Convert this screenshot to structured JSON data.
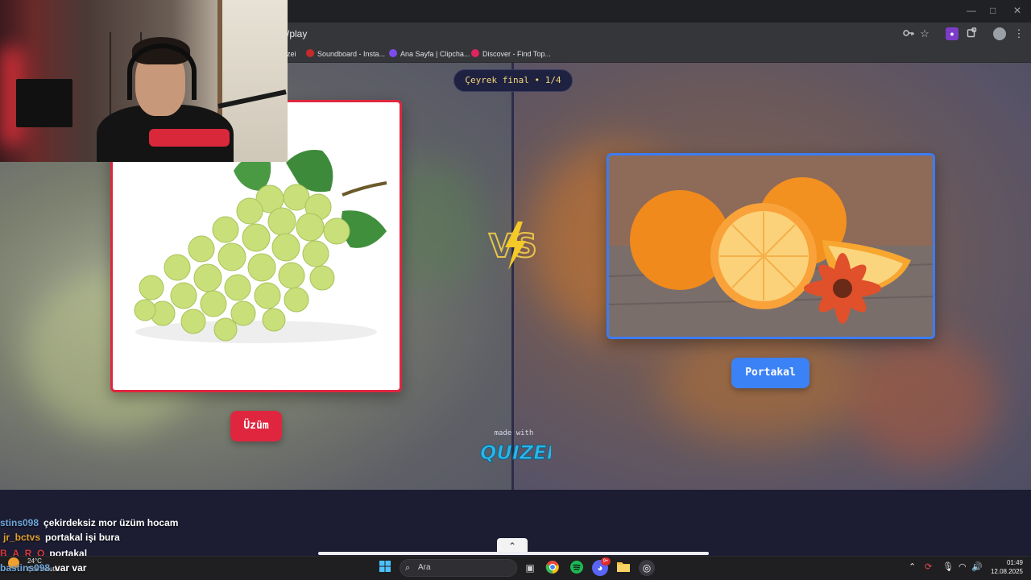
{
  "browser": {
    "url": "/play",
    "bookmarks": [
      {
        "label": "zei",
        "color": "#5e5e5e"
      },
      {
        "label": "Soundboard - Insta...",
        "color": "#c62a2a"
      },
      {
        "label": "Ana Sayfa | Clipcha...",
        "color": "#7d4cf0"
      },
      {
        "label": "Discover - Find Top...",
        "color": "#e0245e"
      }
    ],
    "window_controls": {
      "minimize": "—",
      "maximize": "□",
      "close": "✕"
    },
    "icons": {
      "key": "key-icon",
      "star": "star-icon",
      "extension": "extension-icon",
      "puzzle": "puzzle-icon",
      "menu": "menu-dots-icon"
    }
  },
  "game": {
    "round_label": "Çeyrek final • 1/4",
    "left": {
      "name": "Üzüm",
      "accent": "#e0263f"
    },
    "right": {
      "name": "Portakal",
      "accent": "#3b82f6"
    },
    "vs_text": "VS",
    "made_with": "made with",
    "brand": "QUIZEI"
  },
  "chat": [
    {
      "user": "stins098",
      "user_color": "#6fa8dc",
      "message": "çekirdeksiz mor üzüm hocam"
    },
    {
      "user": "jr_bctvs",
      "user_color": "#e0a030",
      "message": "portakal işi bura"
    },
    {
      "user": "B_A_R_O",
      "user_color": "#d93a3a",
      "message": "portakal"
    },
    {
      "user": "bastins098",
      "user_color": "#6fa8dc",
      "message": "var var"
    }
  ],
  "taskbar": {
    "search_placeholder": "Ara",
    "weather_temp": "24°C",
    "weather_desc": "Çok bulutlu",
    "time": "01:49",
    "date": "12.08.2025",
    "discord_badge": "9+"
  }
}
